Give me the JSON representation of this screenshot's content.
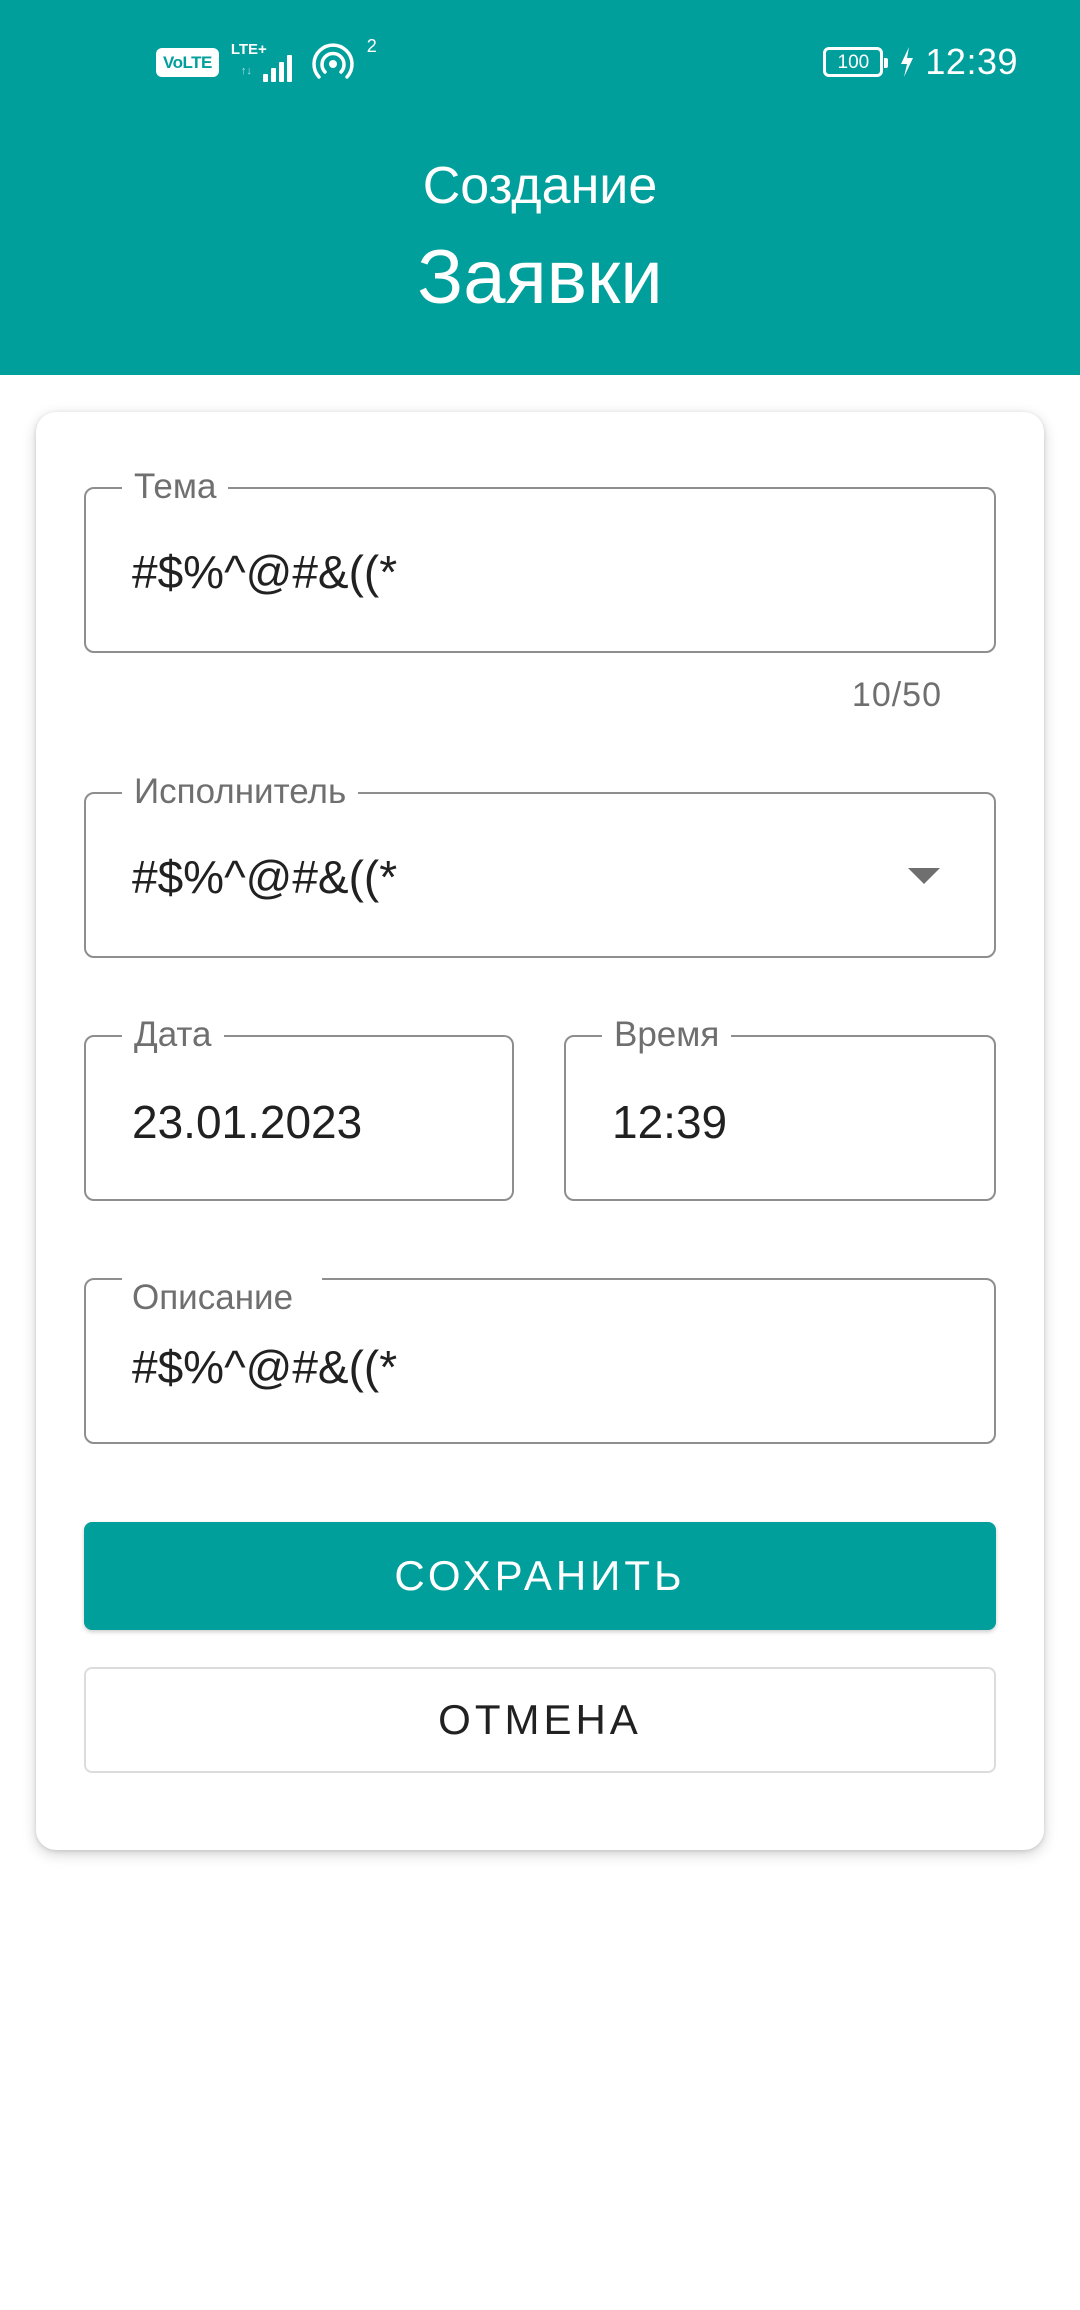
{
  "status_bar": {
    "volte": "VoLTE",
    "lte": "LTE+",
    "lte_arrows": "↑↓",
    "hotspot_count": "2",
    "battery": "100",
    "time": "12:39"
  },
  "header": {
    "line1": "Создание",
    "line2": "Заявки",
    "background_color": "#009f9b"
  },
  "form": {
    "tema": {
      "label": "Тема",
      "value": "#$%^@#&((*",
      "counter": "10/50"
    },
    "ispolnitel": {
      "label": "Исполнитель",
      "value": "#$%^@#&((*",
      "icon": "dropdown-arrow-icon"
    },
    "data": {
      "label": "Дата",
      "value": "23.01.2023"
    },
    "vremya": {
      "label": "Время",
      "value": "12:39"
    },
    "opisanie": {
      "label": "Описание",
      "value": "#$%^@#&((*"
    }
  },
  "buttons": {
    "save": "СОХРАНИТЬ",
    "cancel": "ОТМЕНА"
  }
}
